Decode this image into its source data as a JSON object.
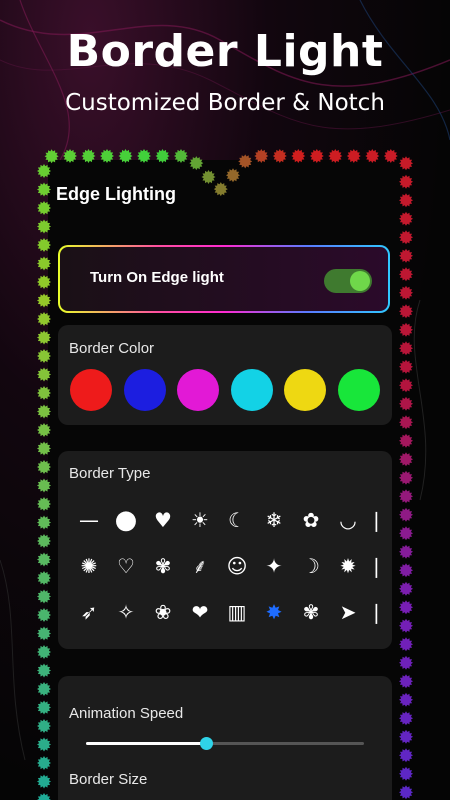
{
  "hero": {
    "title": "Border Light",
    "subtitle": "Customized Border & Notch"
  },
  "screen": {
    "title": "Edge Lighting",
    "toggle": {
      "label": "Turn On Edge light",
      "on": true
    }
  },
  "border_color": {
    "label": "Border Color",
    "colors": [
      "#ee1b1b",
      "#1c1ee0",
      "#e219d6",
      "#13d2e6",
      "#eed812",
      "#18e63a"
    ]
  },
  "border_type": {
    "label": "Border Type",
    "rows": [
      [
        "line-icon",
        "circle-icon",
        "heart-icon",
        "sun-icon",
        "moon-icon",
        "snowflake-icon",
        "flower-outline-icon",
        "lips-icon",
        "partial-icon"
      ],
      [
        "splat-icon",
        "heart-outline-icon",
        "plant-icon",
        "branch-icon",
        "smiley-icon",
        "sparkle-icon",
        "moon-star-icon",
        "starburst-icon",
        "partial-icon"
      ],
      [
        "bird-icon",
        "star-4-icon",
        "hibiscus-icon",
        "heart-solid-icon",
        "drip-icon",
        "blue-burst-icon",
        "butterfly-icon",
        "fish-icon",
        "partial-icon"
      ]
    ]
  },
  "animation": {
    "speed_label": "Animation Speed",
    "speed_value": 0.43,
    "size_label": "Border Size"
  },
  "accent": "#2fd3e8"
}
